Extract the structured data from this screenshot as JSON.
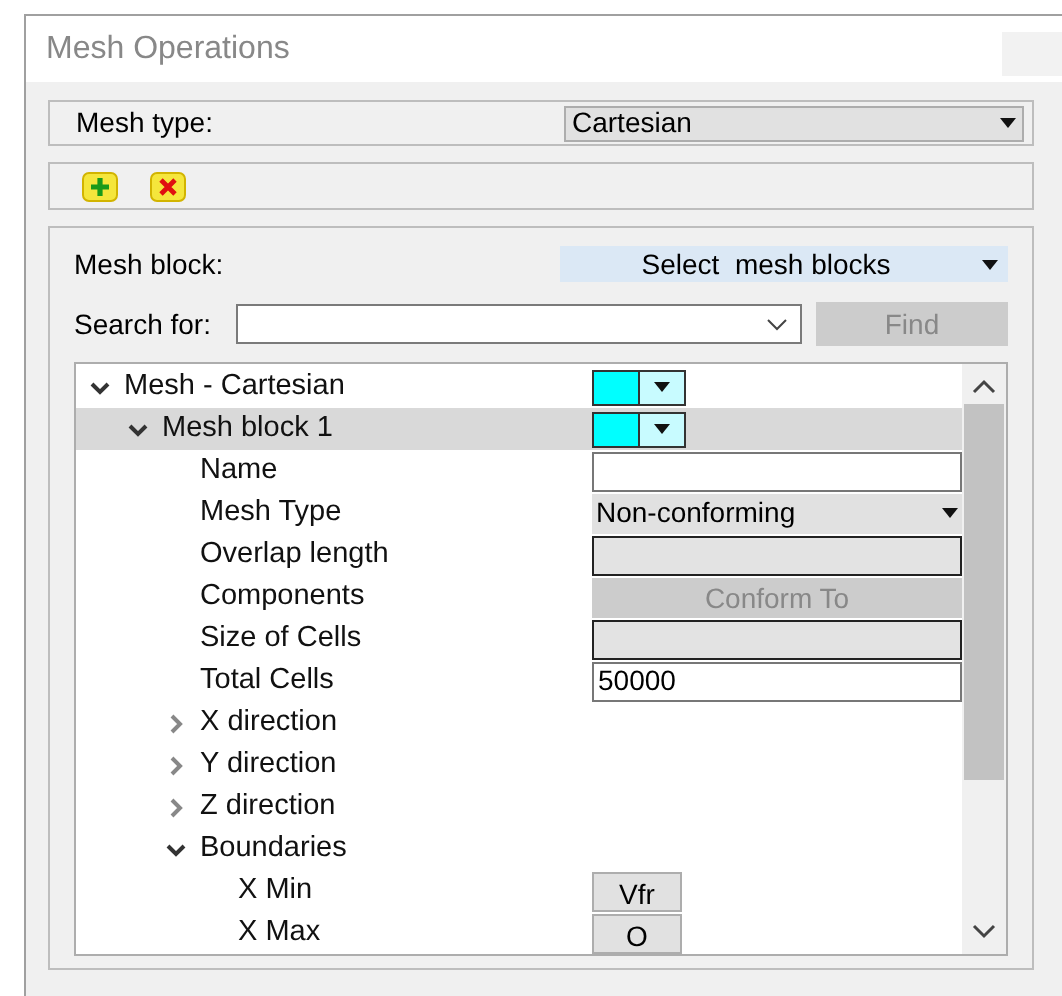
{
  "window": {
    "title": "Mesh Operations"
  },
  "mesh_type": {
    "label": "Mesh type:",
    "value": "Cartesian"
  },
  "toolbar": [
    {
      "kind": "add"
    },
    {
      "kind": "remove"
    }
  ],
  "mesh_block": {
    "label": "Mesh block:",
    "value": "Select  mesh blocks"
  },
  "search": {
    "label": "Search for:",
    "button": "Find",
    "button_disabled": true
  },
  "tree": [
    {
      "label": "Mesh - Cartesian",
      "kind": "swatch",
      "color": "#00ffff",
      "expanded": true,
      "selected": false,
      "children": [
        {
          "label": "Mesh block 1",
          "kind": "swatch",
          "color": "#00ffff",
          "expanded": true,
          "selected": true,
          "children": [
            {
              "label": "Name",
              "kind": "input",
              "disabled": false,
              "selected": false
            },
            {
              "label": "Mesh Type",
              "kind": "select",
              "value": "Non-conforming",
              "selected": false
            },
            {
              "label": "Overlap length",
              "kind": "input",
              "disabled": true,
              "selected": false
            },
            {
              "label": "Components",
              "kind": "button",
              "value": "Conform To",
              "disabled": true,
              "selected": false
            },
            {
              "label": "Size of Cells",
              "kind": "input",
              "disabled": true,
              "selected": false
            },
            {
              "label": "Total Cells",
              "kind": "input",
              "value": "50000",
              "disabled": false,
              "selected": false
            },
            {
              "label": "X direction",
              "kind": "group",
              "expanded": false,
              "selected": false
            },
            {
              "label": "Y direction",
              "kind": "group",
              "expanded": false,
              "selected": false
            },
            {
              "label": "Z direction",
              "kind": "group",
              "expanded": false,
              "selected": false
            },
            {
              "label": "Boundaries",
              "kind": "group",
              "expanded": true,
              "selected": false,
              "children": [
                {
                  "label": "X Min",
                  "kind": "small-button",
                  "value": "Vfr",
                  "selected": false
                },
                {
                  "label": "X Max",
                  "kind": "small-button",
                  "value": "O",
                  "selected": false
                }
              ]
            }
          ]
        }
      ]
    }
  ]
}
